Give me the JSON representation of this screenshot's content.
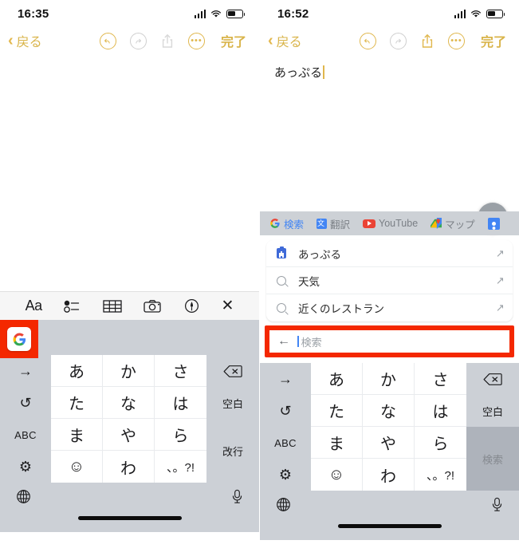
{
  "left": {
    "status": {
      "time": "16:35",
      "signal_icon": "signal-bars-icon",
      "wifi_icon": "wifi-icon",
      "battery_icon": "battery-icon"
    },
    "nav": {
      "back_chevron": "‹",
      "back_label": "戻る",
      "undo_icon": "undo-icon",
      "redo_icon": "redo-icon",
      "share_icon": "share-icon",
      "more_icon": "more-icon",
      "done_label": "完了"
    },
    "note": {
      "text": ""
    },
    "toolbar": {
      "format_label": "Aa",
      "checklist_icon": "checklist-icon",
      "table_icon": "table-icon",
      "camera_icon": "camera-icon",
      "markup_icon": "markup-icon",
      "close_icon": "close-icon"
    },
    "google_button": {
      "icon": "google-g-icon",
      "highlighted": true,
      "highlight_color": "#f42800"
    },
    "keyboard": {
      "fn_keys": [
        "→",
        "↺",
        "ABC",
        "⚙"
      ],
      "kana_rows": [
        [
          "あ",
          "か",
          "さ"
        ],
        [
          "た",
          "な",
          "は"
        ],
        [
          "ま",
          "や",
          "ら"
        ],
        [
          "☺",
          "わ",
          "、。?!"
        ]
      ],
      "delete_icon": "delete-key-icon",
      "space_label": "空白",
      "enter_label": "改行",
      "globe_icon": "globe-icon",
      "mic_icon": "mic-icon"
    }
  },
  "right": {
    "status": {
      "time": "16:52",
      "signal_icon": "signal-bars-icon",
      "wifi_icon": "wifi-icon",
      "battery_icon": "battery-icon"
    },
    "nav": {
      "back_chevron": "‹",
      "back_label": "戻る",
      "undo_icon": "undo-icon",
      "redo_icon": "redo-icon",
      "share_icon": "share-icon",
      "more_icon": "more-icon",
      "done_label": "完了"
    },
    "note": {
      "text": "あっぷる"
    },
    "fab": {
      "label": "+"
    },
    "google_panel": {
      "tabs": [
        {
          "label": "検索",
          "icon": "google-g-icon",
          "active": true
        },
        {
          "label": "翻訳",
          "icon": "translate-icon",
          "active": false
        },
        {
          "label": "YouTube",
          "icon": "youtube-icon",
          "active": false
        },
        {
          "label": "マップ",
          "icon": "maps-icon",
          "active": false
        },
        {
          "label": "",
          "icon": "profile-icon",
          "active": false
        }
      ],
      "suggestions": [
        {
          "text": "あっぷる",
          "icon": "clipboard-icon",
          "arrow": "↖"
        },
        {
          "text": "天気",
          "icon": "search-icon",
          "arrow": "↖"
        },
        {
          "text": "近くのレストラン",
          "icon": "search-icon",
          "arrow": "↖"
        }
      ],
      "search_bar": {
        "back_icon": "←",
        "placeholder": "検索",
        "value": "",
        "highlighted": true,
        "highlight_color": "#f42800"
      }
    },
    "keyboard": {
      "fn_keys": [
        "→",
        "↺",
        "ABC",
        "⚙"
      ],
      "kana_rows": [
        [
          "あ",
          "か",
          "さ"
        ],
        [
          "た",
          "な",
          "は"
        ],
        [
          "ま",
          "や",
          "ら"
        ],
        [
          "☺",
          "わ",
          "、。?!"
        ]
      ],
      "delete_icon": "delete-key-icon",
      "space_label": "空白",
      "enter_label": "検索",
      "globe_icon": "globe-icon",
      "mic_icon": "mic-icon"
    }
  }
}
